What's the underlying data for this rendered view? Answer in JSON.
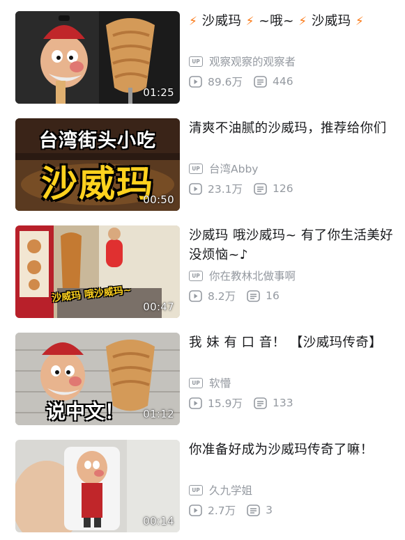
{
  "colors": {
    "accent_orange": "#fb7a18",
    "meta_gray": "#9499a0",
    "title_black": "#18191c"
  },
  "icons": {
    "uploader": "up-badge-icon",
    "views": "play-count-icon",
    "danmaku": "danmaku-count-icon",
    "title_decoration": "lightning-icon"
  },
  "videos": [
    {
      "title_parts": [
        "沙威玛",
        "~哦~",
        "沙威玛"
      ],
      "uploader": "观察观察的观察者",
      "views": "89.6万",
      "danmaku": "446",
      "duration": "01:25"
    },
    {
      "title": "清爽不油腻的沙威玛，推荐给你们",
      "uploader": "台湾Abby",
      "views": "23.1万",
      "danmaku": "126",
      "duration": "00:50",
      "thumb_text_top": "台湾街头小吃",
      "thumb_text_big": "沙威玛"
    },
    {
      "title": "沙威玛 哦沙威玛~ 有了你生活美好没烦恼~♪",
      "uploader": "你在教林北做事啊",
      "views": "8.2万",
      "danmaku": "16",
      "duration": "00:47",
      "thumb_text": "沙威玛 哦沙威玛~"
    },
    {
      "title": "我 妹 有 口 音！ 【沙威玛传奇】",
      "uploader": "软懵",
      "views": "15.9万",
      "danmaku": "133",
      "duration": "01:12",
      "thumb_text": "说中文！"
    },
    {
      "title": "你准备好成为沙威玛传奇了嘛！",
      "uploader": "久九学姐",
      "views": "2.7万",
      "danmaku": "3",
      "duration": "00:14"
    }
  ]
}
